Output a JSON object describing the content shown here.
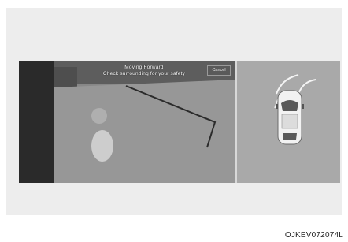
{
  "camera_view": {
    "title_line1": "Moving Forward",
    "title_line2": "Check surrounding for your safety",
    "cancel_label": "Cancel"
  },
  "top_view": {
    "car_icon": "car-top-icon",
    "guide_icon": "parking-guide-lines-icon"
  },
  "caption": "OJKEV072074L"
}
